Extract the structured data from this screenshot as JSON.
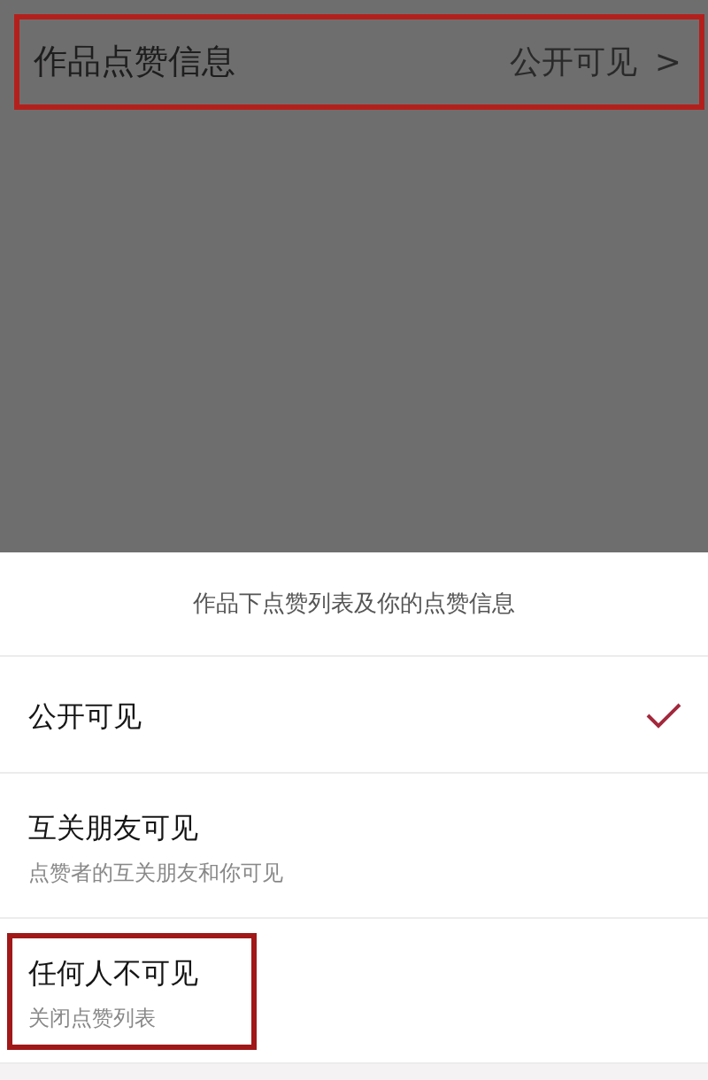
{
  "setting_row": {
    "label": "作品点赞信息",
    "value": "公开可见",
    "chevron": ">",
    "highlighted": true
  },
  "sheet": {
    "title": "作品下点赞列表及你的点赞信息",
    "options": [
      {
        "label": "公开可见",
        "selected": true,
        "highlighted": false
      },
      {
        "label": "互关朋友可见",
        "description": "点赞者的互关朋友和你可见",
        "selected": false,
        "highlighted": false
      },
      {
        "label": "任何人不可见",
        "description": "关闭点赞列表",
        "selected": false,
        "highlighted": true
      }
    ]
  }
}
